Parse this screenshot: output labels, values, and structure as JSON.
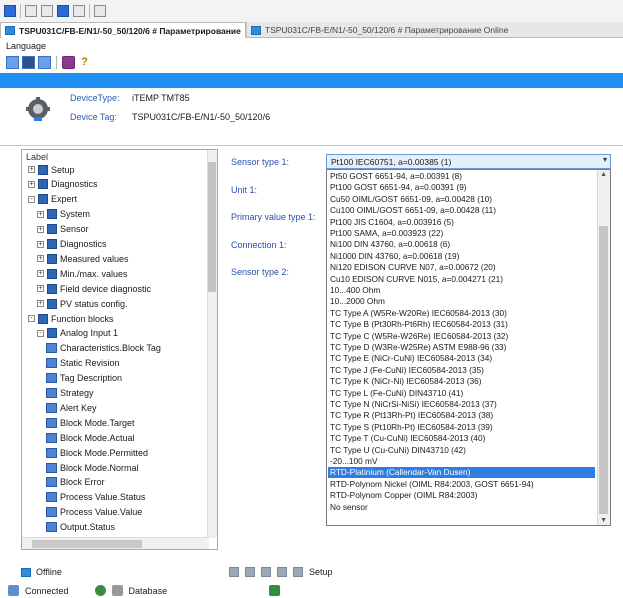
{
  "tabs": [
    {
      "label": "TSPU031C/FB-E/N1/-50_50/120/6 # Параметрирование",
      "active": true
    },
    {
      "label": "TSPU031C/FB-E/N1/-50_50/120/6 # Параметрирование Online",
      "active": false
    }
  ],
  "menu": {
    "language": "Language"
  },
  "toolbar": {
    "help_glyph": "?"
  },
  "device": {
    "type_label": "DeviceType:",
    "type_value": "iTEMP TMT85",
    "tag_label": "Device Tag:",
    "tag_value": "TSPU031C/FB-E/N1/-50_50/120/6"
  },
  "tree": {
    "header": "Label",
    "items": [
      {
        "label": "Setup",
        "level": 0,
        "exp": "+",
        "kind": "folder"
      },
      {
        "label": "Diagnostics",
        "level": 0,
        "exp": "+",
        "kind": "folder"
      },
      {
        "label": "Expert",
        "level": 0,
        "exp": "-",
        "kind": "folder"
      },
      {
        "label": "System",
        "level": 1,
        "exp": "+",
        "kind": "folder"
      },
      {
        "label": "Sensor",
        "level": 1,
        "exp": "+",
        "kind": "folder"
      },
      {
        "label": "Diagnostics",
        "level": 1,
        "exp": "+",
        "kind": "folder"
      },
      {
        "label": "Measured values",
        "level": 1,
        "exp": "+",
        "kind": "folder"
      },
      {
        "label": "Min./max. values",
        "level": 1,
        "exp": "+",
        "kind": "folder"
      },
      {
        "label": "Field device diagnostic",
        "level": 1,
        "exp": "+",
        "kind": "folder"
      },
      {
        "label": "PV status config.",
        "level": 1,
        "exp": "+",
        "kind": "folder"
      },
      {
        "label": "Function blocks",
        "level": 0,
        "exp": "-",
        "kind": "folder"
      },
      {
        "label": "Analog Input 1",
        "level": 1,
        "exp": "-",
        "kind": "folder"
      },
      {
        "label": "Characteristics.Block Tag",
        "level": 2,
        "exp": "",
        "kind": "param"
      },
      {
        "label": "Static Revision",
        "level": 2,
        "exp": "",
        "kind": "param"
      },
      {
        "label": "Tag Description",
        "level": 2,
        "exp": "",
        "kind": "param"
      },
      {
        "label": "Strategy",
        "level": 2,
        "exp": "",
        "kind": "param"
      },
      {
        "label": "Alert Key",
        "level": 2,
        "exp": "",
        "kind": "param"
      },
      {
        "label": "Block Mode.Target",
        "level": 2,
        "exp": "",
        "kind": "param"
      },
      {
        "label": "Block Mode.Actual",
        "level": 2,
        "exp": "",
        "kind": "param"
      },
      {
        "label": "Block Mode.Permitted",
        "level": 2,
        "exp": "",
        "kind": "param"
      },
      {
        "label": "Block Mode.Normal",
        "level": 2,
        "exp": "",
        "kind": "param"
      },
      {
        "label": "Block Error",
        "level": 2,
        "exp": "",
        "kind": "param"
      },
      {
        "label": "Process Value.Status",
        "level": 2,
        "exp": "",
        "kind": "param"
      },
      {
        "label": "Process Value.Value",
        "level": 2,
        "exp": "",
        "kind": "param"
      },
      {
        "label": "Output.Status",
        "level": 2,
        "exp": "",
        "kind": "param"
      }
    ]
  },
  "params": {
    "sensor_type_1": "Sensor type 1:",
    "unit_1": "Unit 1:",
    "primary_value_type_1": "Primary value type 1:",
    "connection_1": "Connection 1:",
    "sensor_type_2": "Sensor type 2:"
  },
  "combo": {
    "selected": "Pt100 IEC60751, a=0.00385 (1)"
  },
  "options": [
    "Pt50 GOST 6651-94, a=0.00391 (8)",
    "Pt100 GOST 6651-94, a=0.00391 (9)",
    "Cu50 OIML/GOST 6651-09, a=0.00428 (10)",
    "Cu100 OIML/GOST 6651-09, a=0.00428 (11)",
    "Pt100 JIS C1604, a=0.003916 (5)",
    "Pt100 SAMA, a=0.003923 (22)",
    "Ni100 DIN 43760, a=0.00618 (6)",
    "Ni1000 DIN 43760, a=0.00618 (19)",
    "Ni120 EDISON CURVE N07, a=0.00672 (20)",
    "Cu10 EDISON CURVE N015, a=0.004271 (21)",
    "10...400 Ohm",
    "10...2000 Ohm",
    "TC Type A (W5Re-W20Re) IEC60584-2013 (30)",
    "TC Type B (Pt30Rh-Pt6Rh) IEC60584-2013 (31)",
    "TC Type C (W5Re-W26Re) IEC60584-2013 (32)",
    "TC Type D (W3Re-W25Re) ASTM E988-96 (33)",
    "TC Type E (NiCr-CuNi) IEC60584-2013 (34)",
    "TC Type J (Fe-CuNi) IEC60584-2013 (35)",
    "TC Type K (NiCr-Ni) IEC60584-2013 (36)",
    "TC Type L (Fe-CuNi) DIN43710 (41)",
    "TC Type N (NiCrSi-NiSi) IEC60584-2013 (37)",
    "TC Type R (Pt13Rh-Pt) IEC60584-2013 (38)",
    "TC Type S (Pt10Rh-Pt) IEC60584-2013 (39)",
    "TC Type T (Cu-CuNi) IEC60584-2013 (40)",
    "TC Type U (Cu-CuNi) DIN43710 (42)",
    "-20...100 mV",
    "RTD-Platinium (Callendar-Van Dusen)",
    "RTD-Polynom Nickel (OIML R84:2003, GOST 6651-94)",
    "RTD-Polynom Copper (OIML R84:2003)",
    "No sensor"
  ],
  "selected_option_index": 26,
  "bottom": {
    "offline_tab": "Offline",
    "connected": "Connected",
    "database": "Database",
    "setup": "Setup"
  },
  "colors": {
    "accent": "#1e8ef0",
    "selection": "#2f7de0",
    "label_blue": "#2a4fb0"
  }
}
